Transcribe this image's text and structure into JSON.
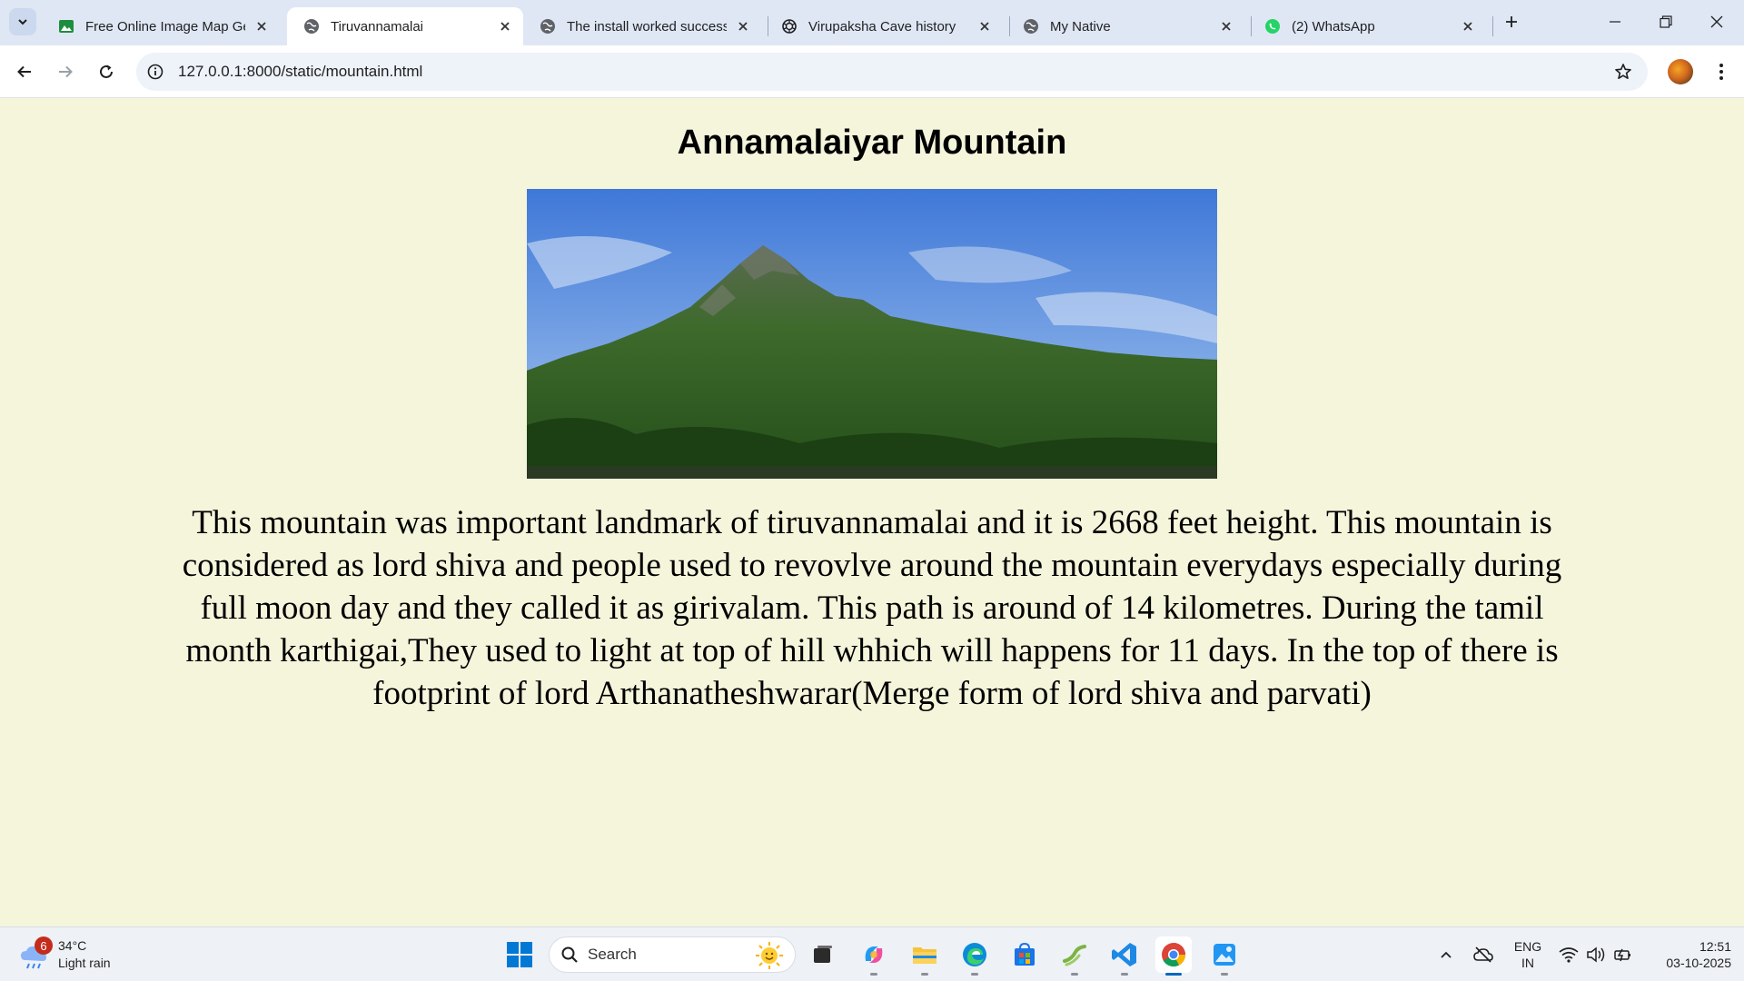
{
  "browser": {
    "tabs": [
      {
        "title": "Free Online Image Map Ge",
        "icon": "image-map-icon",
        "active": false
      },
      {
        "title": "Tiruvannamalai",
        "icon": "globe-icon",
        "active": true
      },
      {
        "title": "The install worked success",
        "icon": "globe-icon",
        "active": false
      },
      {
        "title": "Virupaksha Cave history",
        "icon": "openai-icon",
        "active": false
      },
      {
        "title": "My Native",
        "icon": "globe-icon",
        "active": false
      },
      {
        "title": "(2) WhatsApp",
        "icon": "whatsapp-icon",
        "active": false
      }
    ],
    "url": "127.0.0.1:8000/static/mountain.html"
  },
  "page": {
    "title": "Annamalaiyar Mountain",
    "image_alt_subject": "mountain-photo",
    "paragraph": "This mountain was important landmark of tiruvannamalai and it is 2668 feet height. This mountain is considered as lord shiva and people used to revovlve around the mountain everydays especially during full moon day and they called it as girivalam. This path is around of 14 kilometres. During the tamil month karthigai,They used to light at top of hill whhich will happens for 11 days. In the top of there is footprint of lord Arthanatheshwarar(Merge form of lord shiva and parvati)"
  },
  "taskbar": {
    "weather": {
      "badge": "6",
      "temperature": "34°C",
      "condition": "Light rain"
    },
    "search_label": "Search",
    "language": {
      "line1": "ENG",
      "line2": "IN"
    },
    "clock": {
      "time": "12:51",
      "date": "03-10-2025"
    }
  },
  "colors": {
    "page_background": "#f5f5dc",
    "tabbar_background": "#dfe7f5",
    "accent": "#0067c0"
  }
}
